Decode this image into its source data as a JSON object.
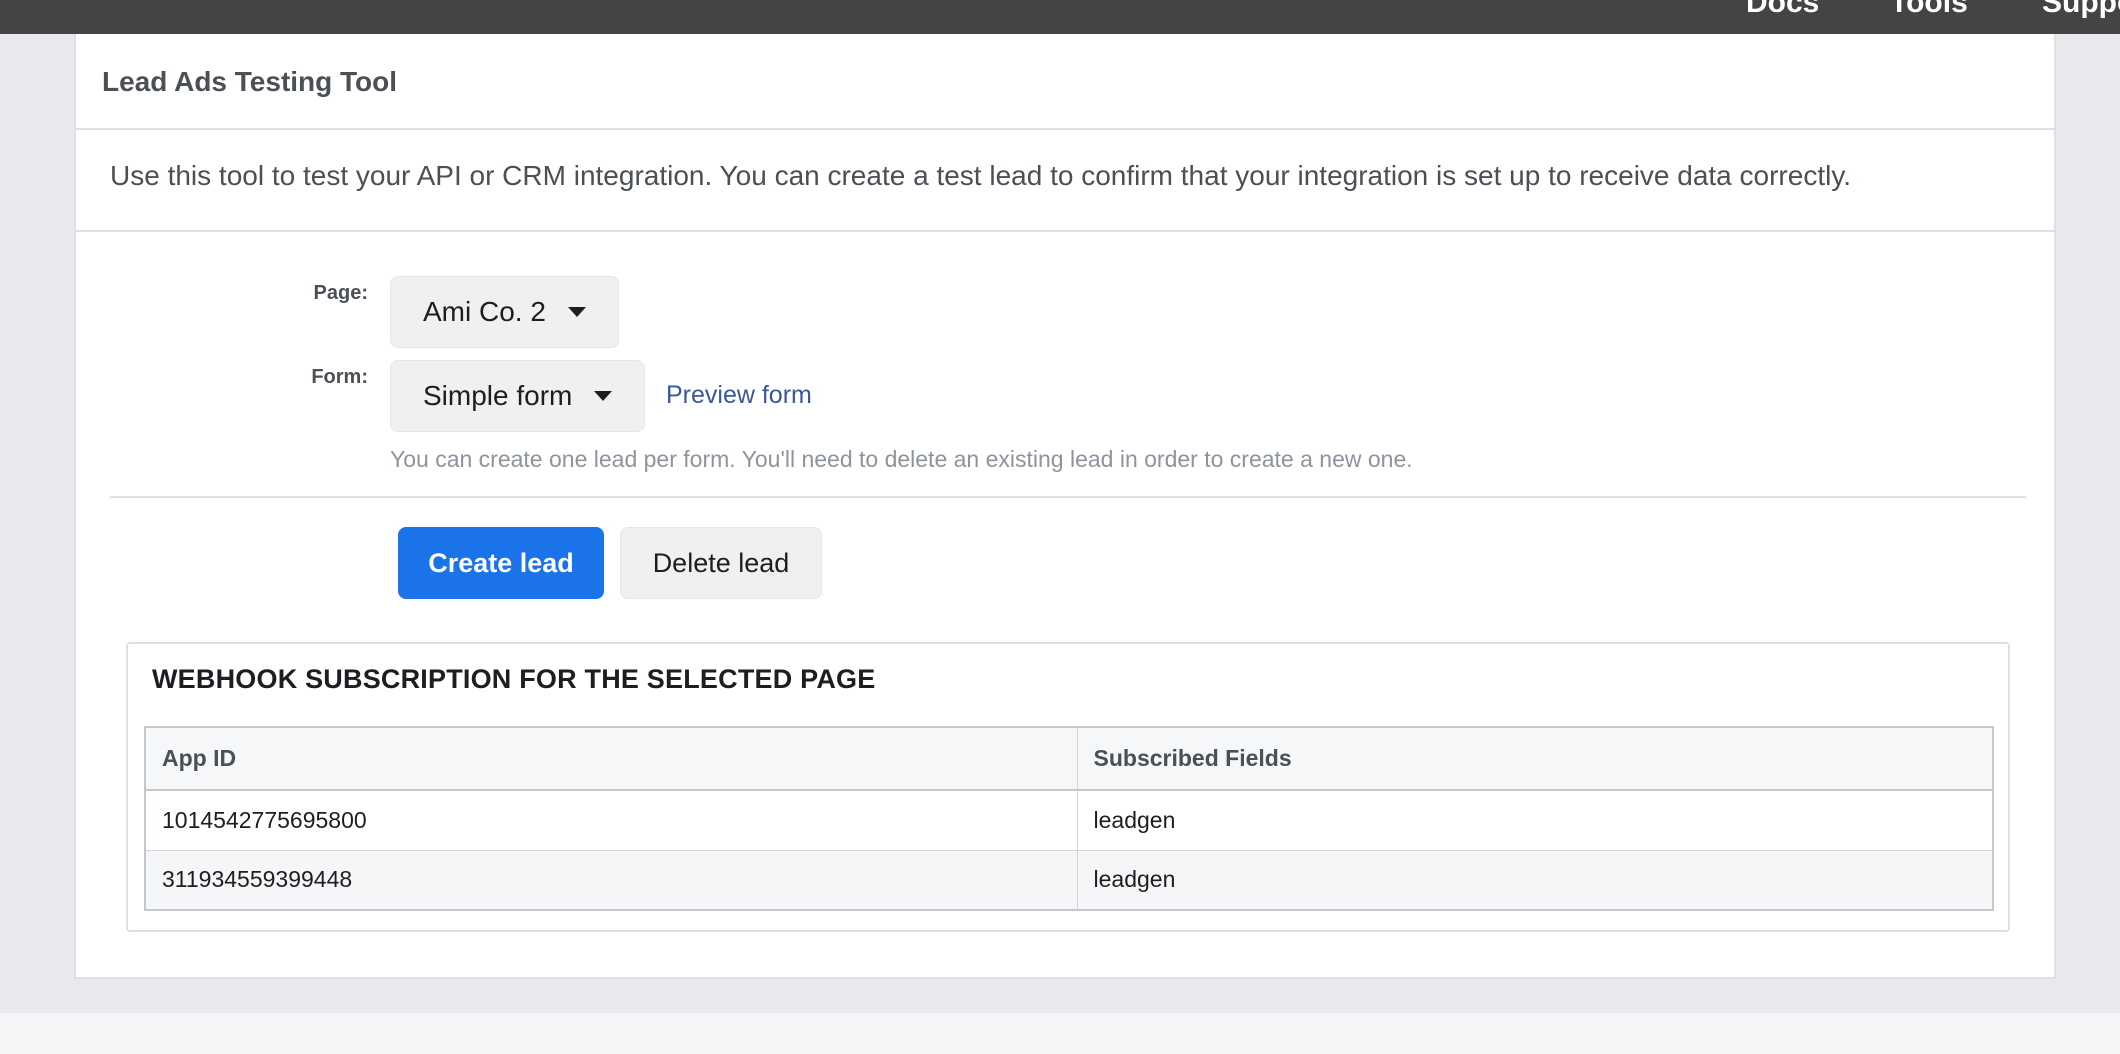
{
  "topnav": {
    "links": [
      "Docs",
      "Tools",
      "Support"
    ]
  },
  "panel": {
    "title": "Lead Ads Testing Tool",
    "intro": "Use this tool to test your API or CRM integration. You can create a test lead to confirm that your integration is set up to receive data correctly."
  },
  "form": {
    "page_label": "Page:",
    "page_value": "Ami Co. 2",
    "form_label": "Form:",
    "form_value": "Simple form",
    "preview_link": "Preview form",
    "help_text": "You can create one lead per form. You'll need to delete an existing lead in order to create a new one."
  },
  "actions": {
    "create_label": "Create lead",
    "delete_label": "Delete lead"
  },
  "webhook": {
    "title": "WEBHOOK SUBSCRIPTION FOR THE SELECTED PAGE",
    "columns": [
      "App ID",
      "Subscribed Fields"
    ],
    "rows": [
      {
        "app_id": "1014542775695800",
        "fields": "leadgen"
      },
      {
        "app_id": "311934559399448",
        "fields": "leadgen"
      }
    ]
  },
  "colors": {
    "topbar": "#444444",
    "primary": "#1a73e8",
    "link": "#385898"
  }
}
